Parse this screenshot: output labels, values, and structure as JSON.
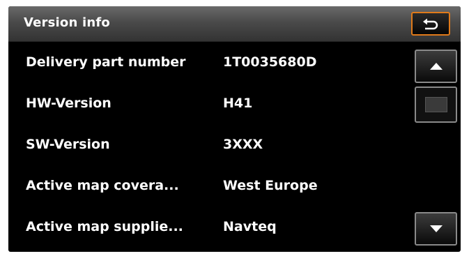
{
  "header": {
    "title": "Version info",
    "back_icon": "back-arrow-icon",
    "accent_color": "#e07a1a"
  },
  "info_rows": [
    {
      "label": "Delivery part number",
      "value": "1T0035680D"
    },
    {
      "label": "HW-Version",
      "value": "H41"
    },
    {
      "label": "SW-Version",
      "value": "3XXX"
    },
    {
      "label": "Active map covera...",
      "value": "West Europe"
    },
    {
      "label": "Active map supplie...",
      "value": "Navteq"
    }
  ],
  "scrollbar": {
    "up_icon": "triangle-up-icon",
    "down_icon": "triangle-down-icon",
    "thumb_icon": "square-icon"
  }
}
